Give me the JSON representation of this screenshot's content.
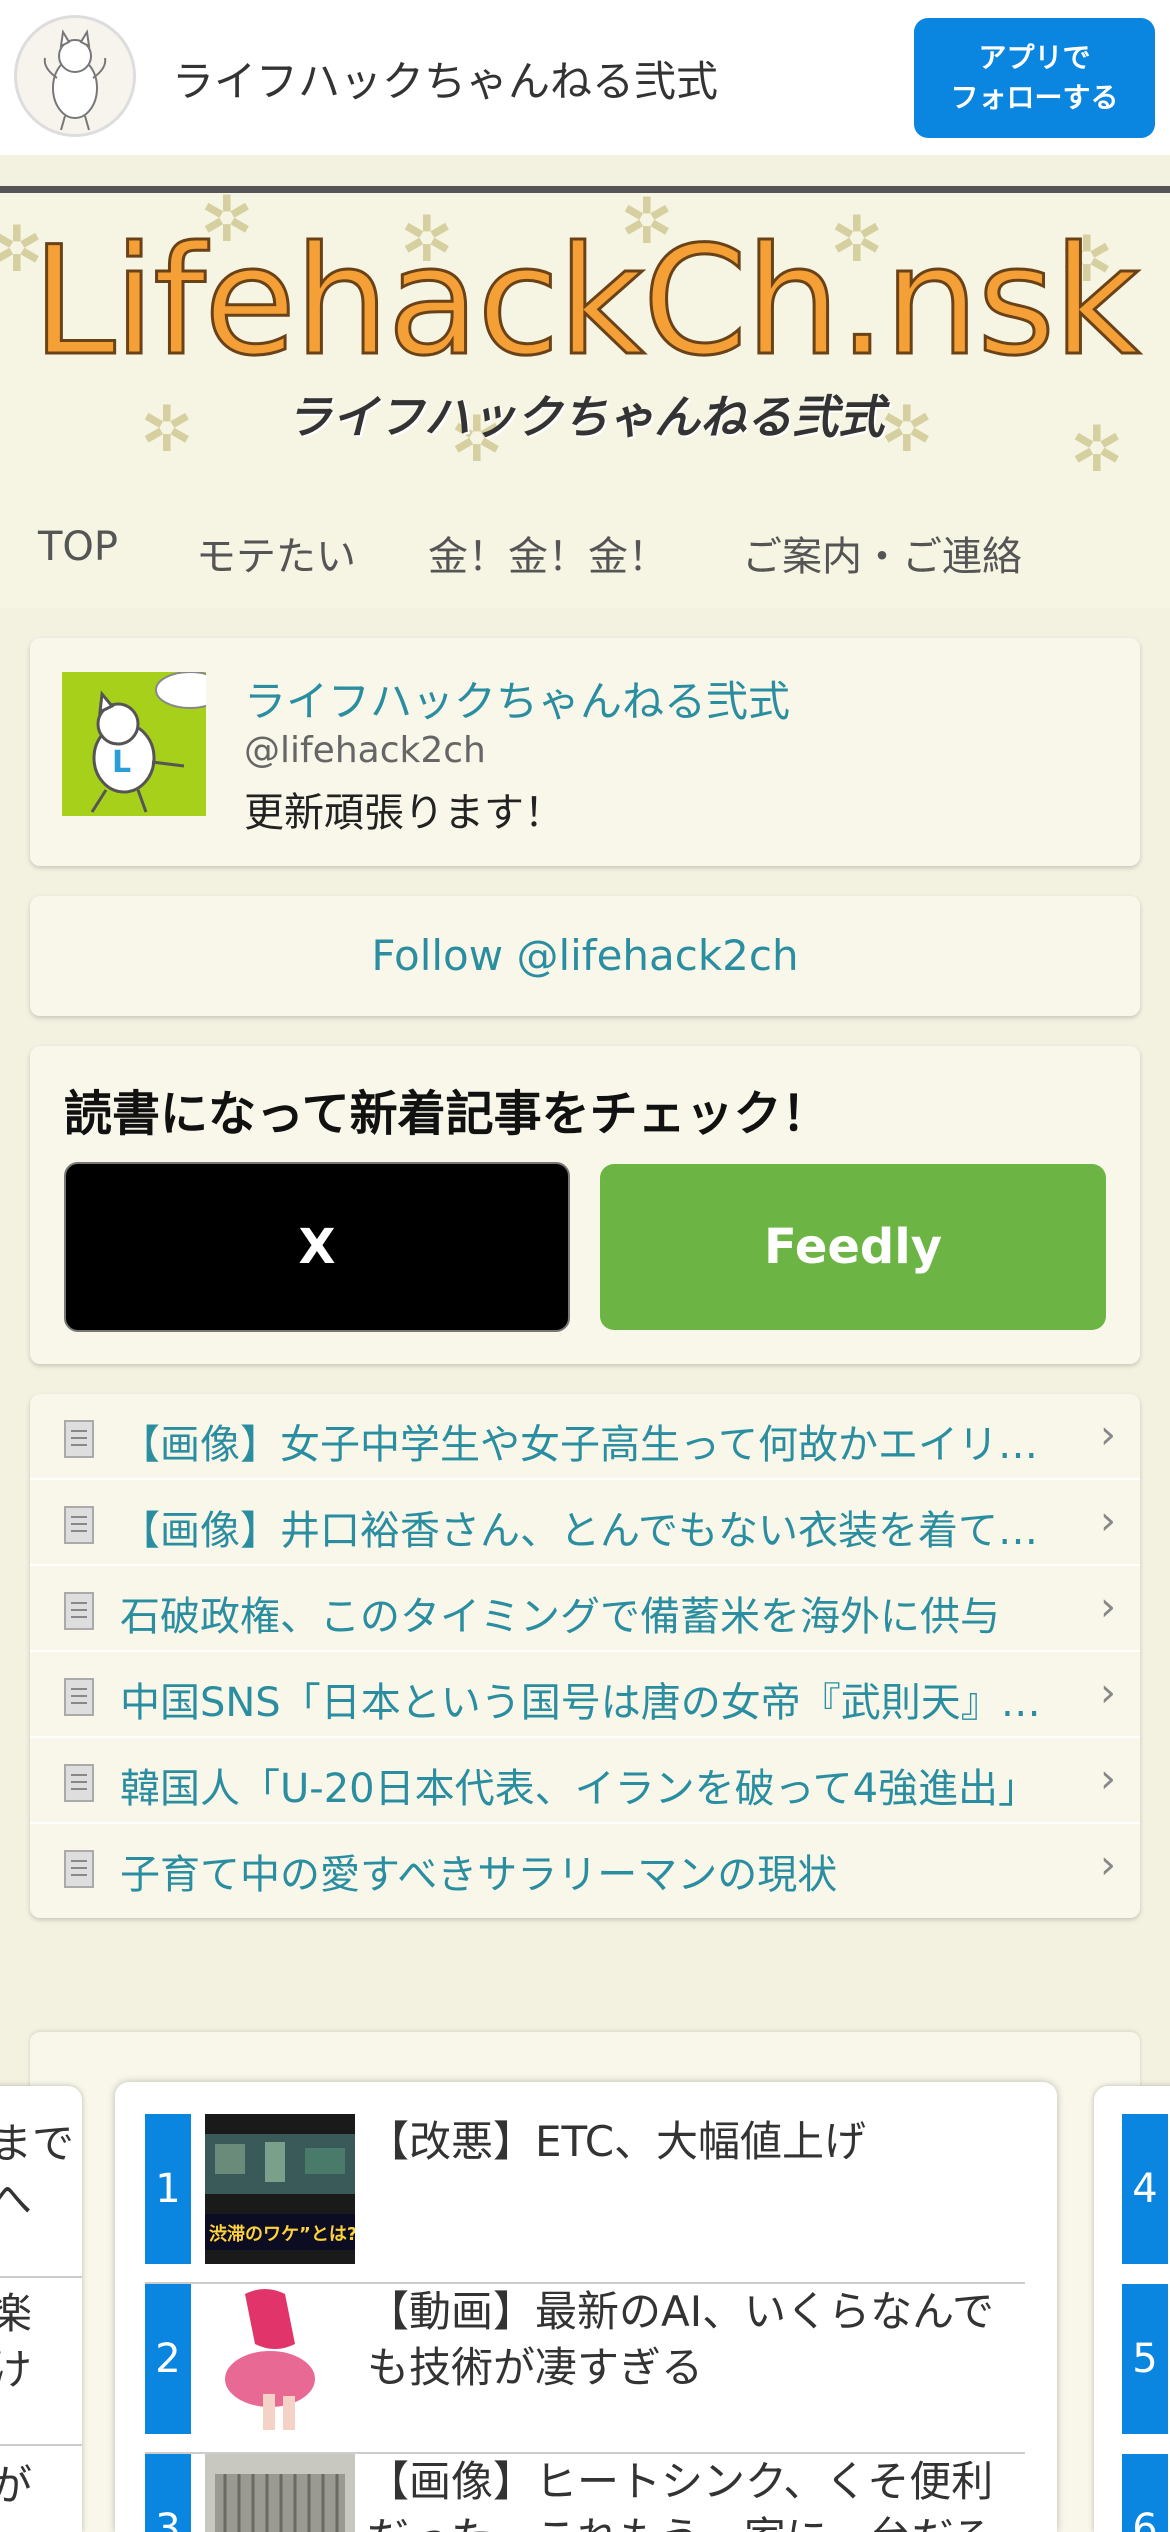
{
  "app_bar": {
    "title": "ライフハックちゃんねる弐式",
    "follow_line1": "アプリで",
    "follow_line2": "フォローする"
  },
  "banner": {
    "logo": "LifehackCh.nsk",
    "subtitle": "ライフハックちゃんねる弐式"
  },
  "nav": {
    "items": [
      "TOP",
      "モテたい",
      "金！金！金！",
      "ご案内・ご連絡"
    ]
  },
  "profile": {
    "name": "ライフハックちゃんねる弐式",
    "handle": "@lifehack2ch",
    "description": "更新頑張ります！"
  },
  "follow_link": "Follow @lifehack2ch",
  "subscribe": {
    "heading": "読書になって新着記事をチェック！",
    "x_label": "X",
    "feedly_label": "Feedly"
  },
  "articles": [
    "【画像】女子中学生や女子高生って何故かエイリアンを",
    "【画像】井口裕香さん、とんでもない衣装を着てしまう",
    "石破政権、このタイミングで備蓄米を海外に供与",
    "中国SNS「日本という国号は唐の女帝『武則天』が与えた",
    "韓国人「U-20日本代表、イランを破って4強進出」",
    "子育て中の愛すべきサラリーマンの現状"
  ],
  "ranking": {
    "items": [
      {
        "num": "1",
        "title": "【改悪】ETC、大幅値上げ",
        "thumb_caption": "渋滞のワケ”とは?"
      },
      {
        "num": "2",
        "title": "【動画】最新のAI、いくらなんでも技術が凄すぎる"
      },
      {
        "num": "3",
        "title": "【画像】ヒートシンク、くそ便利だった…これもう一家に一台だろ"
      }
    ],
    "left_fragments": [
      "まで",
      "へ",
      "楽",
      "け",
      "が"
    ],
    "right_nums": [
      "4",
      "5",
      "6"
    ]
  },
  "colors": {
    "accent_blue": "#0b86e0",
    "link_teal": "#2a8ea0",
    "feedly_green": "#6cb544",
    "logo_orange": "#f4a037"
  }
}
